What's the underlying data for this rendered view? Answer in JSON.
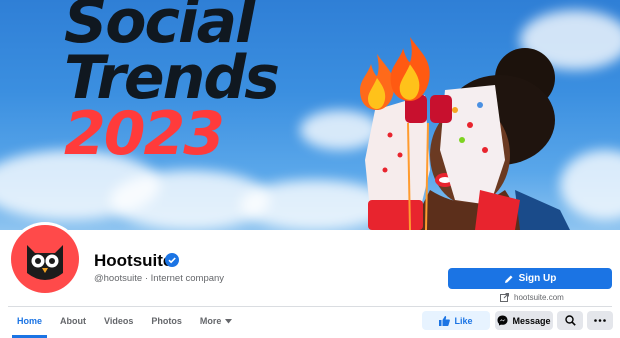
{
  "cover": {
    "headline_line1": "Social",
    "headline_line2": "Trends",
    "headline_line3": "2023"
  },
  "page": {
    "name": "Hootsuite",
    "handle_category": "@hootsuite · Internet company",
    "website": "hootsuite.com"
  },
  "actions": {
    "signup_label": "Sign Up",
    "like_label": "Like",
    "message_label": "Message"
  },
  "tabs": [
    {
      "label": "Home"
    },
    {
      "label": "About"
    },
    {
      "label": "Videos"
    },
    {
      "label": "Photos"
    },
    {
      "label": "More"
    }
  ],
  "colors": {
    "accent": "#1b74e4",
    "headline_dark": "#101820",
    "headline_red": "#ff3b3b",
    "brand_red": "#ff4a4a"
  }
}
